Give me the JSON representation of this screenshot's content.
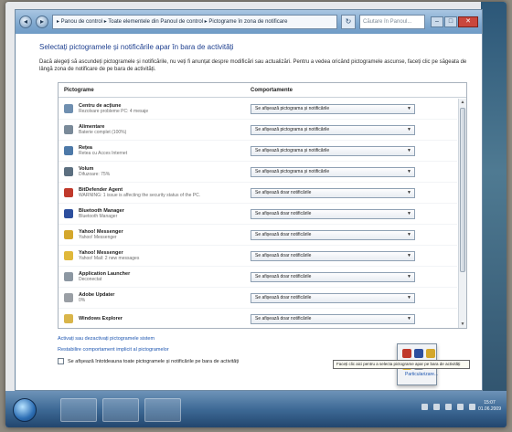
{
  "window": {
    "breadcrumb": "▸ Panou de control ▸ Toate elementele din Panoul de control ▸ Pictograme în zona de notificare",
    "search_placeholder": "Căutare în Panoul...",
    "nav_back": "◂",
    "nav_forward": "▸",
    "refresh": "↻",
    "minimize": "–",
    "maximize": "□",
    "close": "✕"
  },
  "main": {
    "heading": "Selectați pictogramele și notificările apar în bara de activități",
    "description": "Dacă alegeți să ascundeți pictogramele și notificările, nu veți fi anunțat despre modificări sau actualizări. Pentru a vedea oricând pictogramele ascunse, faceți clic pe săgeata de lângă zona de notificare de pe bara de activități."
  },
  "list": {
    "col_icons": "Pictograme",
    "col_behavior": "Comportamente",
    "rows": [
      {
        "name": "Centru de acțiune",
        "sub": "Rezolvare probleme PC: 4 mesaje",
        "behavior": "Se afișează pictograma și notificările",
        "icon_color": "#6f8fb0",
        "icon": "flag-icon"
      },
      {
        "name": "Alimentare",
        "sub": "Baterie complet (100%)",
        "behavior": "Se afișează pictograma și notificările",
        "icon_color": "#7a8a99",
        "icon": "power-icon"
      },
      {
        "name": "Rețea",
        "sub": "Retea cu Acces Internet",
        "behavior": "Se afișează pictograma și notificările",
        "icon_color": "#4d79a8",
        "icon": "network-icon"
      },
      {
        "name": "Volum",
        "sub": "Difuzoare: 75%",
        "behavior": "Se afișează pictograma și notificările",
        "icon_color": "#5c6f80",
        "icon": "volume-icon"
      },
      {
        "name": "BitDefender Agent",
        "sub": "WARNING: 1 issue is affecting the security status of the PC.",
        "behavior": "Se afișează doar notificările",
        "icon_color": "#c0392b",
        "icon": "bitdefender-icon"
      },
      {
        "name": "Bluetooth Manager",
        "sub": "Bluetooth Manager",
        "behavior": "Se afișează doar notificările",
        "icon_color": "#2d4f9e",
        "icon": "bluetooth-icon"
      },
      {
        "name": "Yahoo! Messenger",
        "sub": "Yahoo! Messenger",
        "behavior": "Se afișează doar notificările",
        "icon_color": "#d4a72c",
        "icon": "yahoo-messenger-icon"
      },
      {
        "name": "Yahoo! Messenger",
        "sub": "Yahoo! Mail: 2 new messages",
        "behavior": "Se afișează doar notificările",
        "icon_color": "#e0b83a",
        "icon": "mail-icon"
      },
      {
        "name": "Application Launcher",
        "sub": "Deconectat",
        "behavior": "Se afișează doar notificările",
        "icon_color": "#8c97a2",
        "icon": "launcher-icon"
      },
      {
        "name": "Adobe Updater",
        "sub": "0%",
        "behavior": "Se afișează doar notificările",
        "icon_color": "#9a9fa5",
        "icon": "updater-icon"
      },
      {
        "name": "Windows Explorer",
        "sub": "",
        "behavior": "Se afișează doar notificările",
        "icon_color": "#d9b54a",
        "icon": "folder-icon"
      }
    ]
  },
  "links": {
    "system_icons": "Activați sau dezactivați pictogramele sistem",
    "restore_defaults": "Restabilire comportament implicit al pictogramelor",
    "always_show": "Se afișează întotdeauna toate pictogramele și notificările pe bara de activități"
  },
  "tray": {
    "tooltip": "Faceți clic aici pentru a selecta pictograme apar pe bara de activități",
    "customize": "Particularizare..."
  },
  "clock": {
    "time": "15:07",
    "date": "01.06.2009"
  }
}
